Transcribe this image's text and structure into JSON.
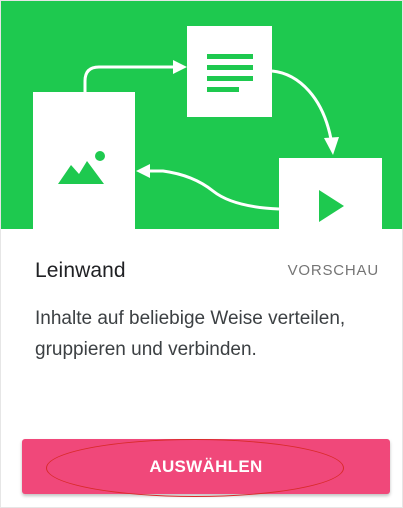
{
  "card": {
    "title": "Leinwand",
    "badge": "VORSCHAU",
    "description": "Inhalte auf beliebige Weise verteilen, gruppieren und verbinden.",
    "button_label": "AUSWÄHLEN"
  },
  "colors": {
    "banner_green": "#1ec94f",
    "button_pink": "#f0487a",
    "annotation_red": "#d92b2b"
  },
  "icons": [
    "image-icon",
    "text-document-icon",
    "play-icon",
    "arrow-icon"
  ]
}
